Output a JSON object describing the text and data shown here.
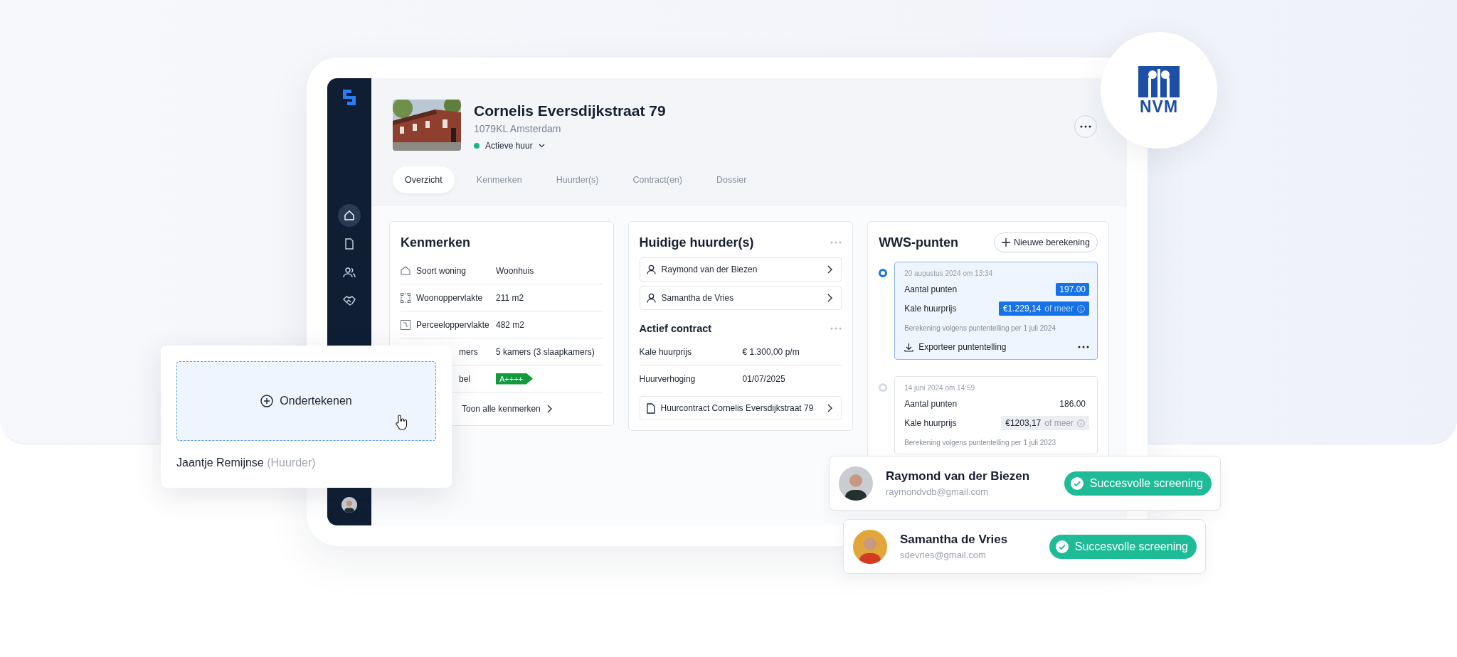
{
  "logo": {
    "text": "NVM"
  },
  "sidebar": {
    "items": [
      {
        "selected": true
      },
      {
        "selected": false
      },
      {
        "selected": false
      },
      {
        "selected": false
      }
    ]
  },
  "property": {
    "title": "Cornelis Eversdijkstraat 79",
    "address": "1079KL Amsterdam",
    "status": "Actieve huur"
  },
  "tabs": [
    {
      "label": "Overzicht",
      "selected": true
    },
    {
      "label": "Kenmerken",
      "selected": false
    },
    {
      "label": "Huurder(s)",
      "selected": false
    },
    {
      "label": "Contract(en)",
      "selected": false
    },
    {
      "label": "Dossier",
      "selected": false
    }
  ],
  "kenmerken": {
    "title": "Kenmerken",
    "rows": [
      {
        "kind": "icon",
        "label": "Soort woning",
        "value": "Woonhuis"
      },
      {
        "kind": "icon",
        "label": "Woonoppervlakte",
        "value": "211 m2"
      },
      {
        "kind": "icon",
        "label": "Perceeloppervlakte",
        "value": "482 m2"
      },
      {
        "kind": "cut",
        "label": "mers",
        "value": "5 kamers (3 slaapkamers)"
      },
      {
        "kind": "cut-energy",
        "label": "bel",
        "value": "A++++"
      }
    ],
    "link": "Toon alle kenmerken"
  },
  "tenants": {
    "title": "Huidige huurder(s)",
    "people": [
      "Raymond van der Biezen",
      "Samantha de Vries"
    ]
  },
  "contract": {
    "title": "Actief contract",
    "rows": [
      {
        "label": "Kale huurprijs",
        "value": "€ 1.300,00 p/m"
      },
      {
        "label": "Huurverhoging",
        "value": "01/07/2025"
      }
    ],
    "document": "Huurcontract Cornelis Eversdijkstraat 79"
  },
  "wws": {
    "title": "WWS-punten",
    "new_button": "Nieuwe berekening",
    "entries": [
      {
        "selected": true,
        "date": "20 augustus 2024 om 13:34",
        "points_label": "Aantal punten",
        "points": "197.00",
        "rent_label": "Kale huurprijs",
        "rent": "€1.229,14",
        "rent_suffix": "of meer",
        "note": "Berekening volgens puntentelling per 1 juli 2024",
        "export": "Exporteer puntentelling"
      },
      {
        "selected": false,
        "date": "14 juni 2024 om 14:59",
        "points_label": "Aantal punten",
        "points": "186.00",
        "rent_label": "Kale huurprijs",
        "rent": "€1203,17",
        "rent_suffix": "of meer",
        "note": "Berekening volgens puntentelling per 1 juli 2023"
      }
    ]
  },
  "sign_card": {
    "button": "Ondertekenen",
    "name": "Jaantje Remijnse",
    "role": "(Huurder)"
  },
  "screenings": [
    {
      "name": "Raymond van der Biezen",
      "email": "raymondvdb@gmail.com",
      "status": "Succesvolle screening"
    },
    {
      "name": "Samantha de Vries",
      "email": "sdevries@gmail.com",
      "status": "Succesvolle screening"
    }
  ]
}
